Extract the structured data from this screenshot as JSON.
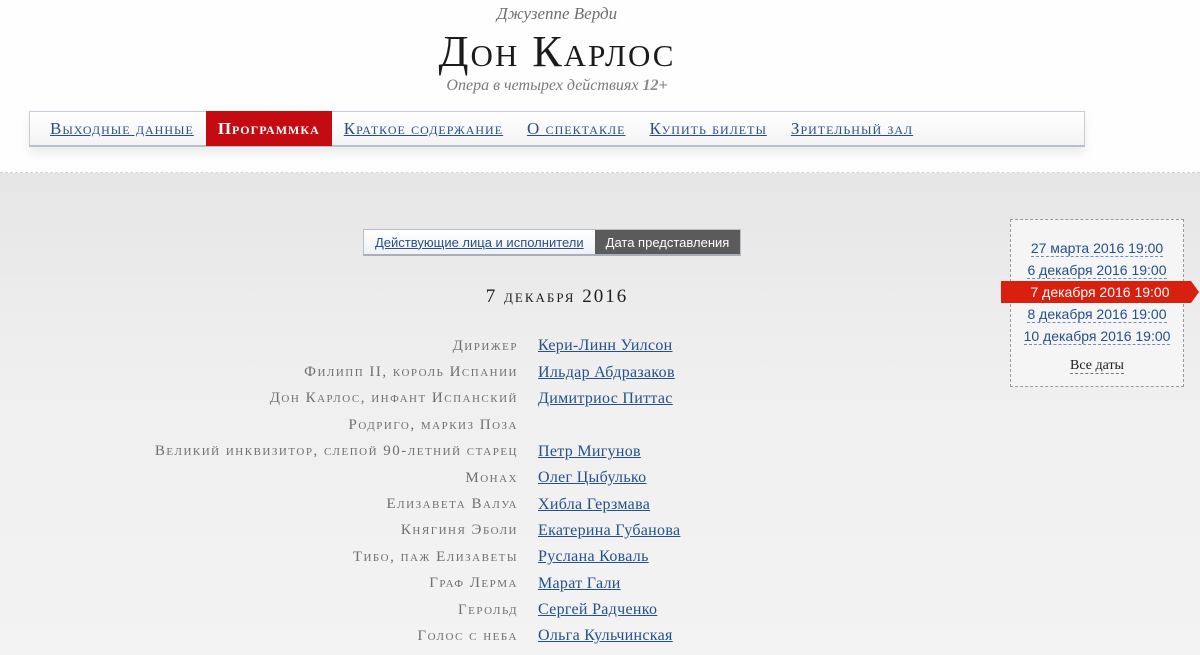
{
  "header": {
    "composer": "Джузеппе Верди",
    "title": "Дон Карлос",
    "subtitle": "Опера в четырех действиях",
    "age_rating": "12+"
  },
  "nav": {
    "items": [
      {
        "label": "Выходные данные"
      },
      {
        "label": "Программка"
      },
      {
        "label": "Краткое содержание"
      },
      {
        "label": "О спектакле"
      },
      {
        "label": "Купить билеты"
      },
      {
        "label": "Зрительный зал"
      }
    ],
    "active_index": 1
  },
  "tabs": [
    {
      "label": "Действующие лица и исполнители"
    },
    {
      "label": "Дата представления"
    }
  ],
  "performance_date": "7 декабря 2016",
  "cast": [
    {
      "role": "Дирижер",
      "performer": "Кери-Линн Уилсон"
    },
    {
      "role": "Филипп II, король Испании",
      "performer": "Ильдар Абдразаков"
    },
    {
      "role": "Дон Карлос, инфант Испанский",
      "performer": "Димитриос Питтас"
    },
    {
      "role": "Родриго, маркиз Поза",
      "performer": ""
    },
    {
      "role": "Великий инквизитор, слепой 90-летний старец",
      "performer": "Петр Мигунов"
    },
    {
      "role": "Монах",
      "performer": "Олег Цыбулько"
    },
    {
      "role": "Елизавета Валуа",
      "performer": "Хибла Герзмава"
    },
    {
      "role": "Княгиня Эболи",
      "performer": "Екатерина Губанова"
    },
    {
      "role": "Тибо, паж Елизаветы",
      "performer": "Руслана Коваль"
    },
    {
      "role": "Граф Лерма",
      "performer": "Марат Гали"
    },
    {
      "role": "Герольд",
      "performer": "Сергей Радченко"
    },
    {
      "role": "Голос с неба",
      "performer": "Ольга Кульчинская"
    }
  ],
  "dates_panel": {
    "dates": [
      "27 марта 2016 19:00",
      "6 декабря 2016 19:00",
      "7 декабря 2016 19:00",
      "8 декабря 2016 19:00",
      "10 декабря 2016 19:00"
    ],
    "active_index": 2,
    "all_dates_label": "Все даты"
  },
  "colors": {
    "accent_red": "#c40b12",
    "link_blue": "#24508c",
    "active_tab": "#5b5b5b"
  }
}
